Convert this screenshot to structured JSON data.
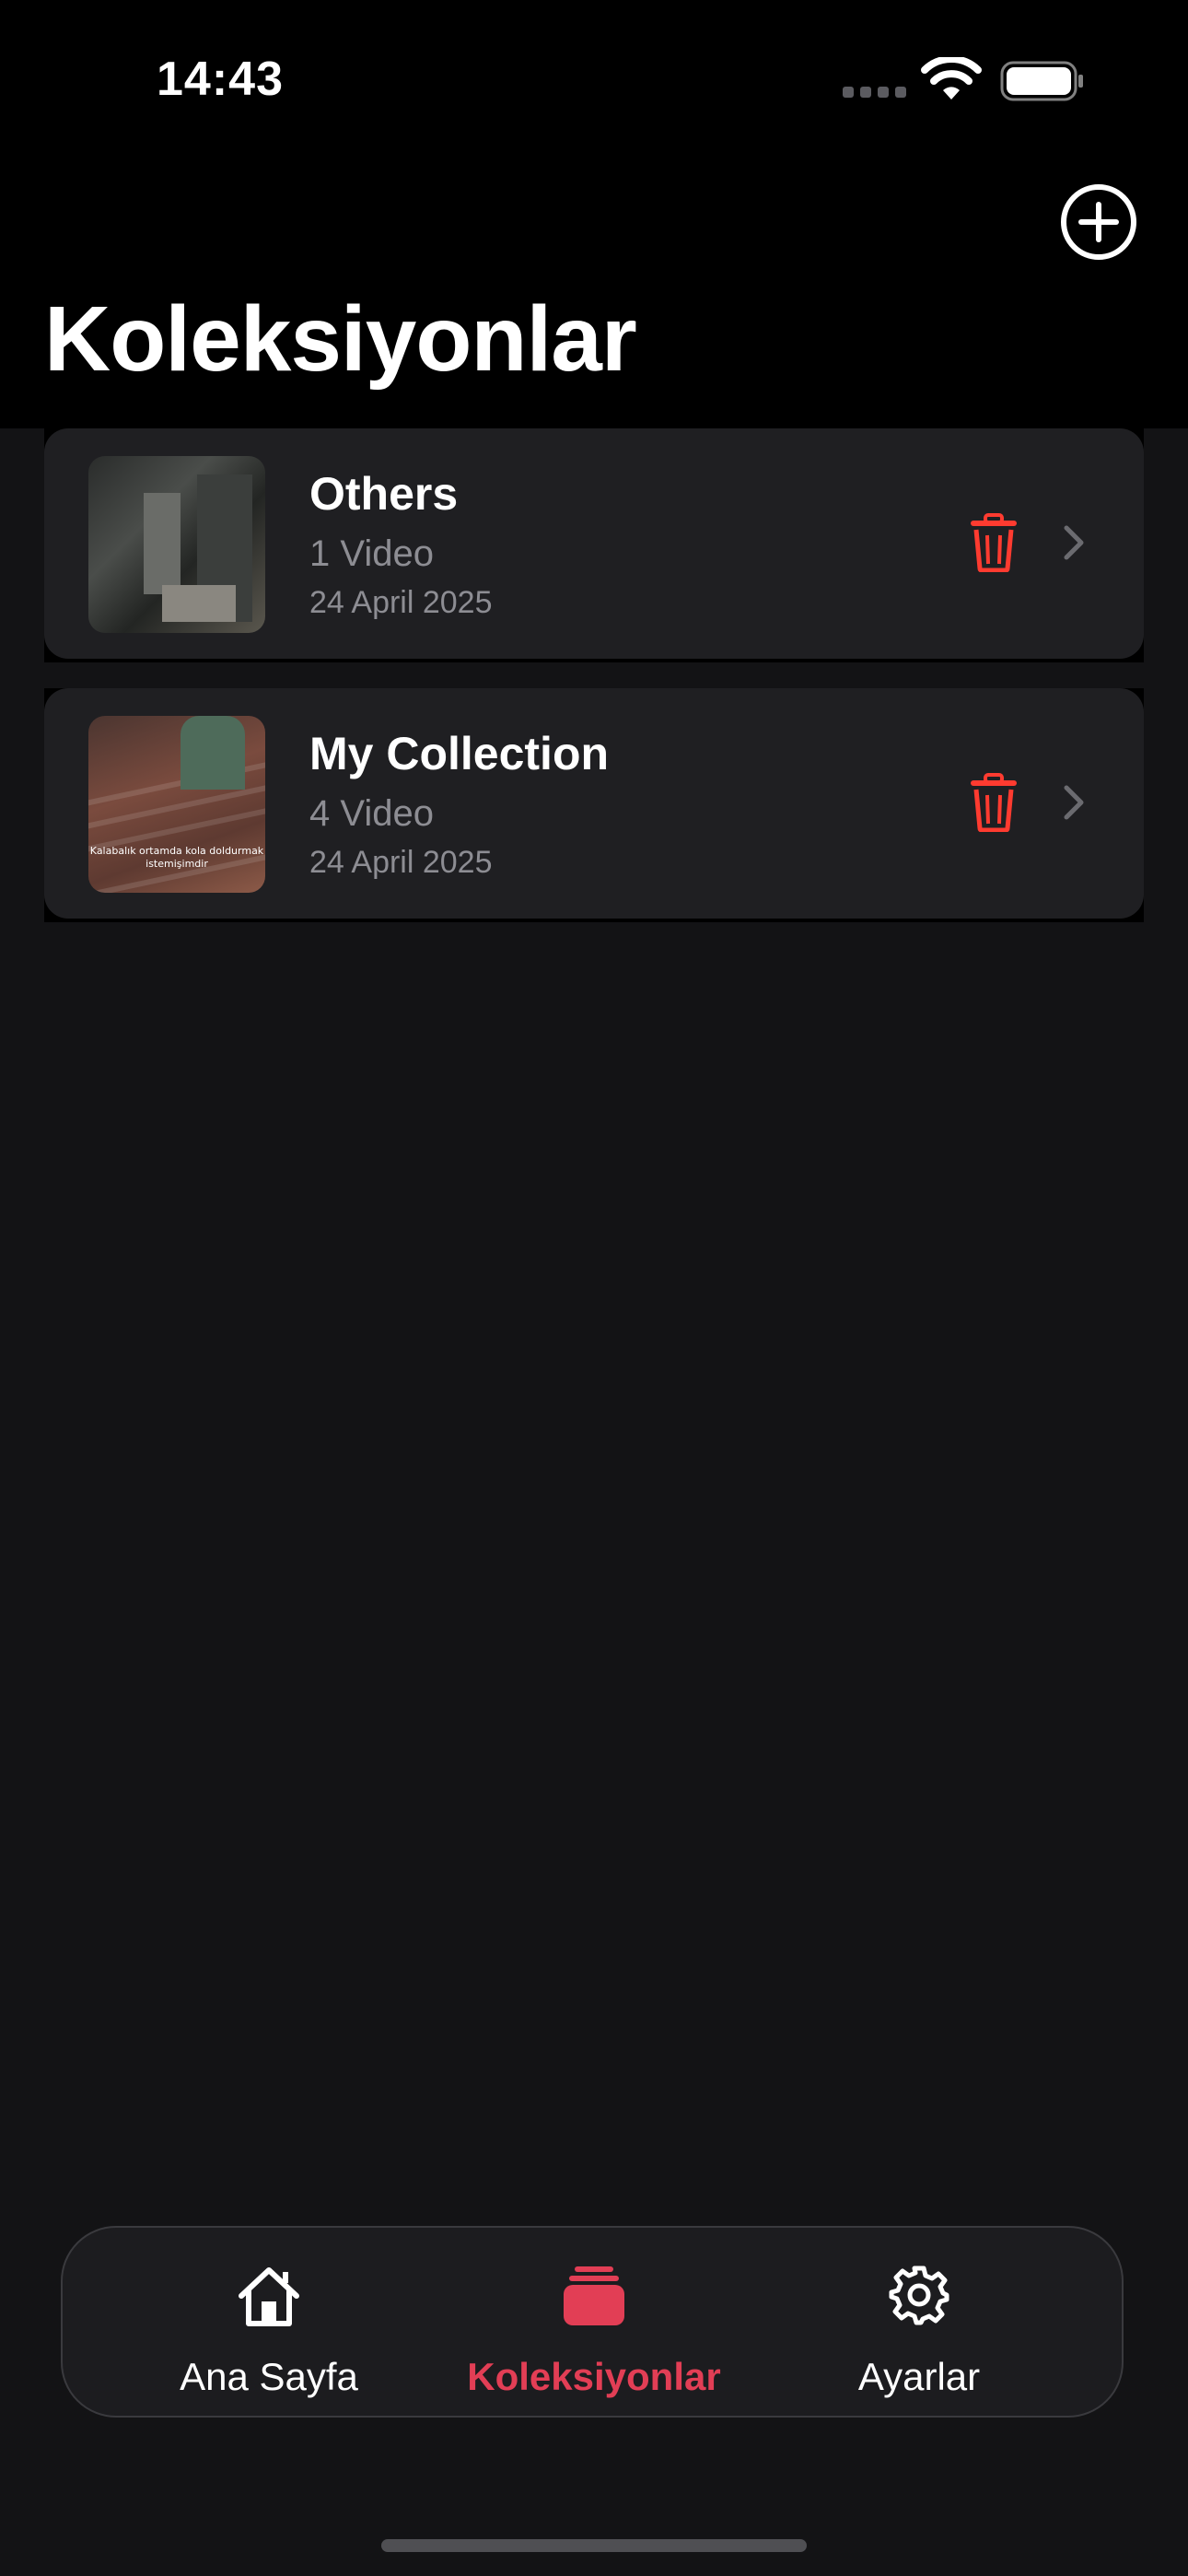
{
  "status_bar": {
    "time": "14:43"
  },
  "header": {
    "title": "Koleksiyonlar",
    "add_icon": "plus-circle-icon"
  },
  "collections": [
    {
      "name": "Others",
      "count": "1 Video",
      "date": "24 April 2025",
      "thumbnail_caption": ""
    },
    {
      "name": "My Collection",
      "count": "4 Video",
      "date": "24 April 2025",
      "thumbnail_caption": "Kalabalık ortamda kola doldurmak istemişimdir"
    }
  ],
  "tab_bar": {
    "tabs": [
      {
        "label": "Ana Sayfa",
        "icon": "house-icon",
        "active": false
      },
      {
        "label": "Koleksiyonlar",
        "icon": "stack-icon",
        "active": true
      },
      {
        "label": "Ayarlar",
        "icon": "gear-icon",
        "active": false
      }
    ]
  },
  "colors": {
    "accent": "#e23e55",
    "delete": "#ff3b30",
    "card": "#1f1f22",
    "background": "#131315"
  }
}
